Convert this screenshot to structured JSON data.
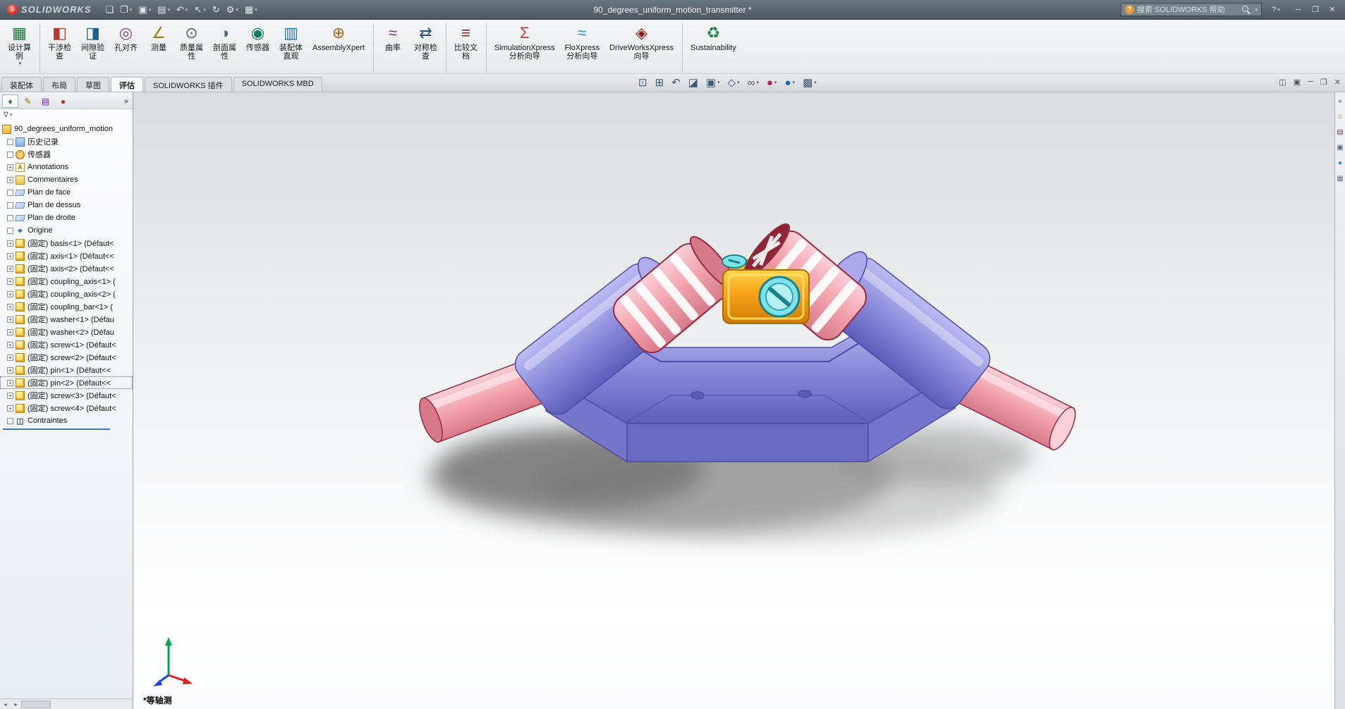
{
  "titlebar": {
    "app_name": "SOLIDWORKS",
    "logo_mark": "S",
    "document_title": "90_degrees_uniform_motion_transmitter *",
    "search_placeholder": "搜索 SOLIDWORKS 帮助",
    "help_button": "?",
    "quick_access": [
      {
        "name": "new-file-icon",
        "glyph": "❏",
        "dd": false
      },
      {
        "name": "open-file-icon",
        "glyph": "❐",
        "dd": true
      },
      {
        "name": "save-icon",
        "glyph": "▣",
        "dd": true
      },
      {
        "name": "print-icon",
        "glyph": "▤",
        "dd": true
      },
      {
        "name": "undo-icon",
        "glyph": "↶",
        "dd": true
      },
      {
        "name": "select-icon",
        "glyph": "↖",
        "dd": true
      },
      {
        "name": "rebuild-icon",
        "glyph": "↻",
        "dd": false
      },
      {
        "name": "options-icon",
        "glyph": "⚙",
        "dd": true
      },
      {
        "name": "file-properties-icon",
        "glyph": "▦",
        "dd": true
      }
    ],
    "window_buttons": [
      {
        "name": "minimize-button",
        "glyph": "─"
      },
      {
        "name": "maximize-button",
        "glyph": "❐"
      },
      {
        "name": "close-button",
        "glyph": "✕"
      }
    ]
  },
  "ribbon": {
    "buttons": [
      {
        "label": "设计算\n例",
        "glyph": "▦",
        "color": "#1f7a3d",
        "dd": true,
        "cls": "div-after"
      },
      {
        "label": "干涉检\n查",
        "glyph": "◧",
        "color": "#b03a2e",
        "dd": false,
        "cls": ""
      },
      {
        "label": "间隙验\n证",
        "glyph": "◨",
        "color": "#1f618d",
        "dd": false,
        "cls": ""
      },
      {
        "label": "孔对齐",
        "glyph": "◎",
        "color": "#7d3c98",
        "dd": false,
        "cls": ""
      },
      {
        "label": "测量",
        "glyph": "∠",
        "color": "#9c7a00",
        "dd": false,
        "cls": ""
      },
      {
        "label": "质量属\n性",
        "glyph": "⊙",
        "color": "#566573",
        "dd": false,
        "cls": ""
      },
      {
        "label": "剖面属\n性",
        "glyph": "◑",
        "color": "#566573",
        "dd": false,
        "cls": ""
      },
      {
        "label": "传感器",
        "glyph": "◉",
        "color": "#117a65",
        "dd": false,
        "cls": ""
      },
      {
        "label": "装配体\n直观",
        "glyph": "▥",
        "color": "#2874a6",
        "dd": false,
        "cls": ""
      },
      {
        "label": "AssemblyXpert",
        "glyph": "⊕",
        "color": "#af601a",
        "dd": false,
        "cls": "div-after"
      },
      {
        "label": "曲率",
        "glyph": "≈",
        "color": "#6c3483",
        "dd": false,
        "cls": ""
      },
      {
        "label": "对称检\n查",
        "glyph": "⇄",
        "color": "#1a5276",
        "dd": false,
        "cls": "div-after"
      },
      {
        "label": "比较文\n档",
        "glyph": "≡",
        "color": "#7b241c",
        "dd": false,
        "cls": "div-after"
      },
      {
        "label": "SimulationXpress\n分析向导",
        "glyph": "Σ",
        "color": "#c0392b",
        "dd": false,
        "cls": ""
      },
      {
        "label": "FloXpress\n分析向导",
        "glyph": "≈",
        "color": "#2e86c1",
        "dd": false,
        "cls": ""
      },
      {
        "label": "DriveWorksXpress\n向导",
        "glyph": "◈",
        "color": "#8b1a1a",
        "dd": false,
        "cls": "div-after"
      },
      {
        "label": "Sustainability",
        "glyph": "♻",
        "color": "#1e8449",
        "dd": false,
        "cls": ""
      }
    ]
  },
  "tabs": {
    "items": [
      {
        "label": "装配体",
        "cls": ""
      },
      {
        "label": "布局",
        "cls": ""
      },
      {
        "label": "草图",
        "cls": ""
      },
      {
        "label": "评估",
        "cls": "active"
      },
      {
        "label": "SOLIDWORKS 插件",
        "cls": ""
      },
      {
        "label": "SOLIDWORKS MBD",
        "cls": ""
      }
    ]
  },
  "headsup": {
    "icons": [
      {
        "name": "zoom-fit-icon",
        "glyph": "⊡",
        "color": "#3d5a73",
        "dd": false
      },
      {
        "name": "zoom-area-icon",
        "glyph": "⊞",
        "color": "#3d5a73",
        "dd": false
      },
      {
        "name": "previous-view-icon",
        "glyph": "↶",
        "color": "#3d5a73",
        "dd": false
      },
      {
        "name": "section-view-icon",
        "glyph": "◪",
        "color": "#3d5a73",
        "dd": false
      },
      {
        "name": "view-orientation-icon",
        "glyph": "▣",
        "color": "#3d5a73",
        "dd": true
      },
      {
        "name": "display-style-icon",
        "glyph": "◇",
        "color": "#3d5a73",
        "dd": true
      },
      {
        "name": "hide-show-items-icon",
        "glyph": "∞",
        "color": "#3d5a73",
        "dd": true
      },
      {
        "name": "edit-appearance-icon",
        "glyph": "●",
        "color": "#c2185b",
        "dd": true
      },
      {
        "name": "apply-scene-icon",
        "glyph": "●",
        "color": "#1565c0",
        "dd": true
      },
      {
        "name": "view-settings-icon",
        "glyph": "▩",
        "color": "#3d5a73",
        "dd": true
      }
    ]
  },
  "doc_controls": [
    {
      "name": "viewport-split-icon",
      "glyph": "◫"
    },
    {
      "name": "viewport-single-icon",
      "glyph": "▣"
    },
    {
      "name": "doc-minimize-icon",
      "glyph": "─"
    },
    {
      "name": "doc-restore-icon",
      "glyph": "❐"
    },
    {
      "name": "doc-close-icon",
      "glyph": "✕"
    }
  ],
  "panel": {
    "tabs": [
      {
        "name": "featuremanager-tab-icon",
        "glyph": "♦",
        "color": "#2e7d32",
        "cls": "first"
      },
      {
        "name": "propertymanager-tab-icon",
        "glyph": "✎",
        "color": "#9c6500",
        "cls": ""
      },
      {
        "name": "configurationmanager-tab-icon",
        "glyph": "▤",
        "color": "#6a1b9a",
        "cls": ""
      },
      {
        "name": "displaymanager-tab-icon",
        "glyph": "●",
        "color": "#c62828",
        "cls": ""
      }
    ],
    "chevron": "»",
    "filter": {
      "glyph": "∇",
      "dd": "▾"
    },
    "tree": [
      {
        "label": "90_degrees_uniform_motion",
        "icon": "assembly-icon",
        "glyph": "",
        "expcls": "exp-none",
        "expglyph": "",
        "pad": "3px",
        "cls": ""
      },
      {
        "label": "历史记录",
        "icon": "history-icon",
        "glyph": "",
        "expcls": "exp-blank",
        "expglyph": "",
        "pad": "10px",
        "cls": ""
      },
      {
        "label": "传感器",
        "icon": "sensors-icon",
        "glyph": "",
        "expcls": "exp-blank",
        "expglyph": "",
        "pad": "10px",
        "cls": ""
      },
      {
        "label": "Annotations",
        "icon": "annotations-icon",
        "glyph": "A",
        "expcls": "",
        "expglyph": "+",
        "pad": "10px",
        "cls": ""
      },
      {
        "label": "Commentaires",
        "icon": "folder-icon",
        "glyph": "",
        "expcls": "",
        "expglyph": "+",
        "pad": "10px",
        "cls": ""
      },
      {
        "label": "Plan de face",
        "icon": "plane-icon",
        "glyph": "",
        "expcls": "exp-blank",
        "expglyph": "",
        "pad": "10px",
        "cls": ""
      },
      {
        "label": "Plan de dessus",
        "icon": "plane-icon",
        "glyph": "",
        "expcls": "exp-blank",
        "expglyph": "",
        "pad": "10px",
        "cls": ""
      },
      {
        "label": "Plan de droite",
        "icon": "plane-icon",
        "glyph": "",
        "expcls": "exp-blank",
        "expglyph": "",
        "pad": "10px",
        "cls": ""
      },
      {
        "label": "Origine",
        "icon": "origin-icon",
        "glyph": "⌖",
        "expcls": "exp-blank",
        "expglyph": "",
        "pad": "10px",
        "cls": ""
      },
      {
        "label": "(固定) basis<1> (Défaut<",
        "icon": "part-icon",
        "glyph": "",
        "expcls": "",
        "expglyph": "+",
        "pad": "10px",
        "cls": ""
      },
      {
        "label": "(固定) axis<1> (Défaut<<",
        "icon": "part-icon",
        "glyph": "",
        "expcls": "",
        "expglyph": "+",
        "pad": "10px",
        "cls": ""
      },
      {
        "label": "(固定) axis<2> (Défaut<<",
        "icon": "part-icon",
        "glyph": "",
        "expcls": "",
        "expglyph": "+",
        "pad": "10px",
        "cls": ""
      },
      {
        "label": "(固定) coupling_axis<1> (",
        "icon": "part-icon",
        "glyph": "",
        "expcls": "",
        "expglyph": "+",
        "pad": "10px",
        "cls": ""
      },
      {
        "label": "(固定) coupling_axis<2> (",
        "icon": "part-icon",
        "glyph": "",
        "expcls": "",
        "expglyph": "+",
        "pad": "10px",
        "cls": ""
      },
      {
        "label": "(固定) coupling_bar<1> (",
        "icon": "part-icon",
        "glyph": "",
        "expcls": "",
        "expglyph": "+",
        "pad": "10px",
        "cls": ""
      },
      {
        "label": "(固定) washer<1> (Défau",
        "icon": "part-icon",
        "glyph": "",
        "expcls": "",
        "expglyph": "+",
        "pad": "10px",
        "cls": ""
      },
      {
        "label": "(固定) washer<2> (Défau",
        "icon": "part-icon",
        "glyph": "",
        "expcls": "",
        "expglyph": "+",
        "pad": "10px",
        "cls": ""
      },
      {
        "label": "(固定) screw<1> (Défaut<",
        "icon": "part-icon",
        "glyph": "",
        "expcls": "",
        "expglyph": "+",
        "pad": "10px",
        "cls": ""
      },
      {
        "label": "(固定) screw<2> (Défaut<",
        "icon": "part-icon",
        "glyph": "",
        "expcls": "",
        "expglyph": "+",
        "pad": "10px",
        "cls": ""
      },
      {
        "label": "(固定) pin<1> (Défaut<<",
        "icon": "part-icon",
        "glyph": "",
        "expcls": "",
        "expglyph": "+",
        "pad": "10px",
        "cls": ""
      },
      {
        "label": "(固定) pin<2> (Défaut<<",
        "icon": "part-icon",
        "glyph": "",
        "expcls": "",
        "expglyph": "+",
        "pad": "10px",
        "cls": "focused"
      },
      {
        "label": "(固定) screw<3> (Défaut<",
        "icon": "part-icon",
        "glyph": "",
        "expcls": "",
        "expglyph": "+",
        "pad": "10px",
        "cls": ""
      },
      {
        "label": "(固定) screw<4> (Défaut<",
        "icon": "part-icon",
        "glyph": "",
        "expcls": "",
        "expglyph": "+",
        "pad": "10px",
        "cls": ""
      },
      {
        "label": "Contraintes",
        "icon": "mates-icon",
        "glyph": "◫",
        "expcls": "exp-blank",
        "expglyph": "",
        "pad": "10px",
        "cls": ""
      }
    ],
    "hscroll": {
      "left_arrow": "◂",
      "right_arrow": "▸"
    }
  },
  "viewport": {
    "view_label": "*等轴测"
  },
  "taskpane": {
    "icons": [
      {
        "name": "collapse-taskpane-icon",
        "glyph": "«",
        "color": "#44515c"
      },
      {
        "name": "resources-icon",
        "glyph": "⌂",
        "color": "#b26a00"
      },
      {
        "name": "design-library-icon",
        "glyph": "▤",
        "color": "#6d4c41"
      },
      {
        "name": "file-explorer-icon",
        "glyph": "▣",
        "color": "#546e7a"
      },
      {
        "name": "appearances-icon",
        "glyph": "●",
        "color": "#1e88e5"
      },
      {
        "name": "custom-properties-icon",
        "glyph": "▦",
        "color": "#607d8b"
      }
    ]
  },
  "model": {
    "description": "universal joint 90-degree motion transmitter assembly",
    "colors": {
      "purple_light": "#bcbcf3",
      "purple": "#8a8ada",
      "purple_dark": "#5d5dbb",
      "purple_edge": "#4c4ca3",
      "purple_face": "#6a6ac2",
      "purple_bevel": "#7575cc",
      "pink_light": "#fbcfd6",
      "pink": "#f2a0ab",
      "pink_dark": "#d67a8a",
      "pink_edge": "#932c41",
      "orange_light": "#ffd44d",
      "orange": "#f5a11a",
      "orange_dark": "#cf7d00",
      "orange_edge": "#a96d00",
      "cyan": "#7ee2e8",
      "cyan_light": "#b5f0f4",
      "cyan_dark": "#1a828e",
      "maroon": "#8e2537",
      "shadow": "#8a8a8a",
      "triad_x": "#e02020",
      "triad_y": "#00a550",
      "triad_z": "#2244dd"
    }
  }
}
